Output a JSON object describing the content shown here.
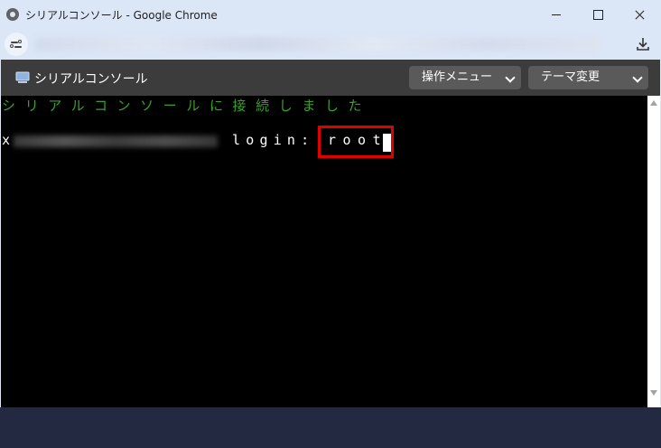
{
  "window": {
    "title": "シリアルコンソール - Google Chrome"
  },
  "app": {
    "title": "シリアルコンソール",
    "menu_select": "操作メニュー",
    "theme_select": "テーマ変更"
  },
  "terminal": {
    "connected_message": "シリアルコンソールに接続しました",
    "host_prefix": "x",
    "login_prompt": "login:",
    "typed_input": "root"
  },
  "colors": {
    "terminal_bg": "#000000",
    "connected_text": "#3aa02a",
    "highlight_border": "#e00000",
    "header_bg": "#3c3c3c"
  },
  "icons": {
    "site": "site-info-icon",
    "download": "download-icon",
    "app": "monitor-icon"
  }
}
